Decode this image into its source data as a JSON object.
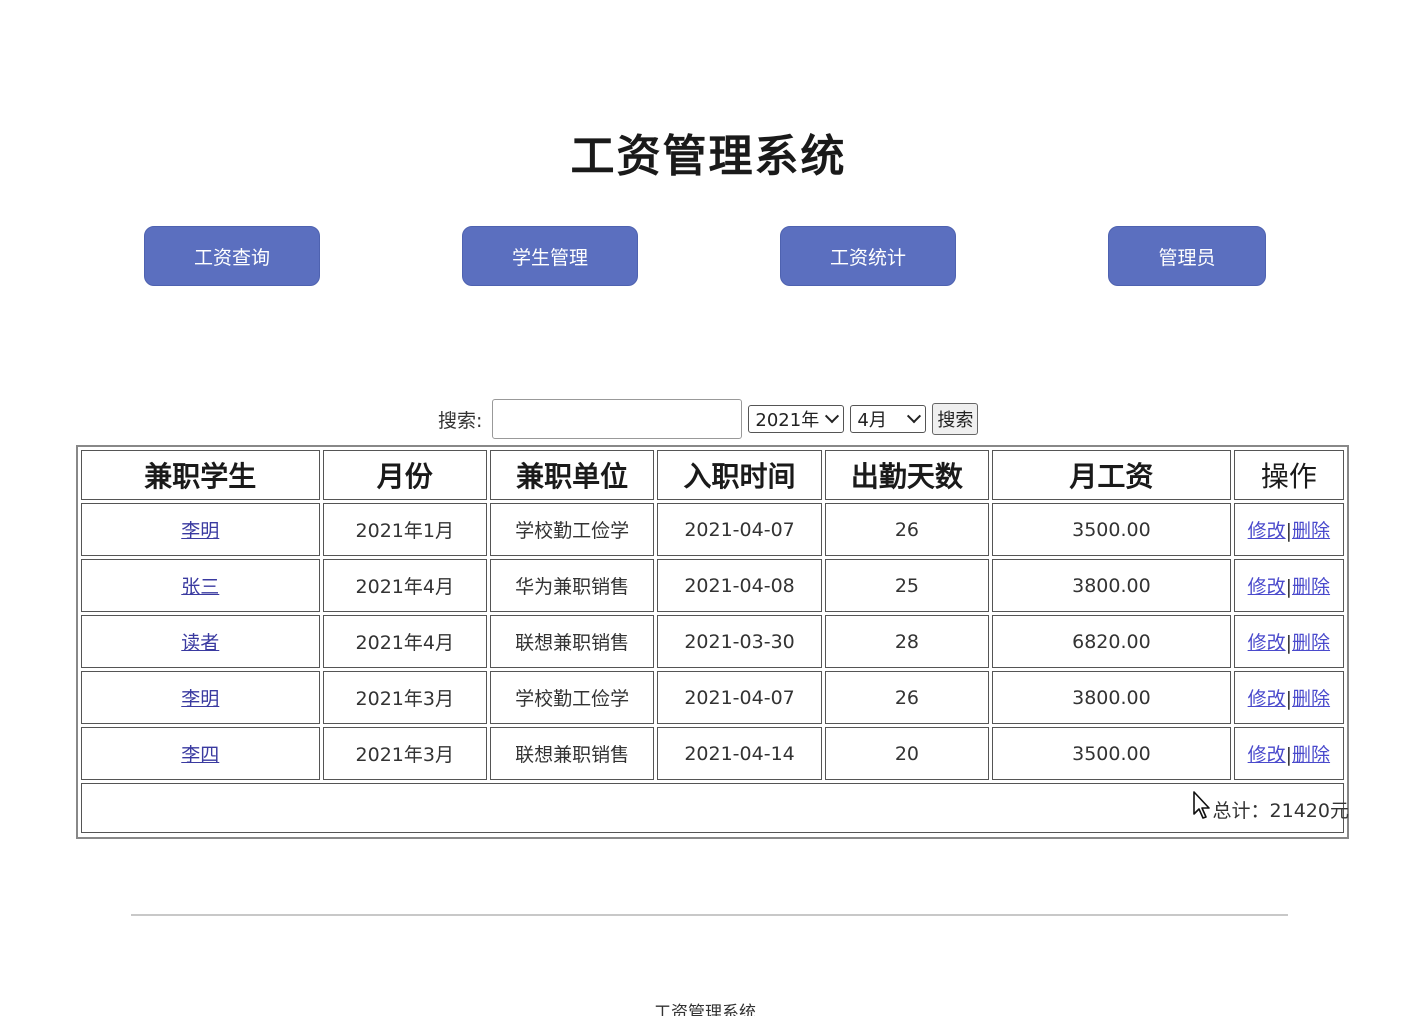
{
  "header": {
    "title": "工资管理系统"
  },
  "nav": [
    {
      "label": "工资查询"
    },
    {
      "label": "学生管理"
    },
    {
      "label": "工资统计"
    },
    {
      "label": "管理员"
    }
  ],
  "search": {
    "label": "搜索:",
    "value": "",
    "placeholder": "",
    "year_selected": "2021年",
    "month_selected": "4月",
    "button_label": "搜索"
  },
  "table": {
    "headers": [
      "兼职学生",
      "月份",
      "兼职单位",
      "入职时间",
      "出勤天数",
      "月工资",
      "操作"
    ],
    "rows": [
      {
        "student": "李明",
        "month": "2021年1月",
        "unit": "学校勤工俭学",
        "hire_date": "2021-04-07",
        "days": "26",
        "salary": "3500.00",
        "edit": "修改",
        "sep": "|",
        "delete": "删除"
      },
      {
        "student": "张三",
        "month": "2021年4月",
        "unit": "华为兼职销售",
        "hire_date": "2021-04-08",
        "days": "25",
        "salary": "3800.00",
        "edit": "修改",
        "sep": "|",
        "delete": "删除"
      },
      {
        "student": "读者",
        "month": "2021年4月",
        "unit": "联想兼职销售",
        "hire_date": "2021-03-30",
        "days": "28",
        "salary": "6820.00",
        "edit": "修改",
        "sep": "|",
        "delete": "删除"
      },
      {
        "student": "李明",
        "month": "2021年3月",
        "unit": "学校勤工俭学",
        "hire_date": "2021-04-07",
        "days": "26",
        "salary": "3800.00",
        "edit": "修改",
        "sep": "|",
        "delete": "删除"
      },
      {
        "student": "李四",
        "month": "2021年3月",
        "unit": "联想兼职销售",
        "hire_date": "2021-04-14",
        "days": "20",
        "salary": "3500.00",
        "edit": "修改",
        "sep": "|",
        "delete": "删除"
      }
    ],
    "total": "总计：21420元"
  },
  "footer": {
    "title": "工资管理系统"
  },
  "colors": {
    "nav_button": "#5b6fbf",
    "link": "#3a3aa0"
  }
}
